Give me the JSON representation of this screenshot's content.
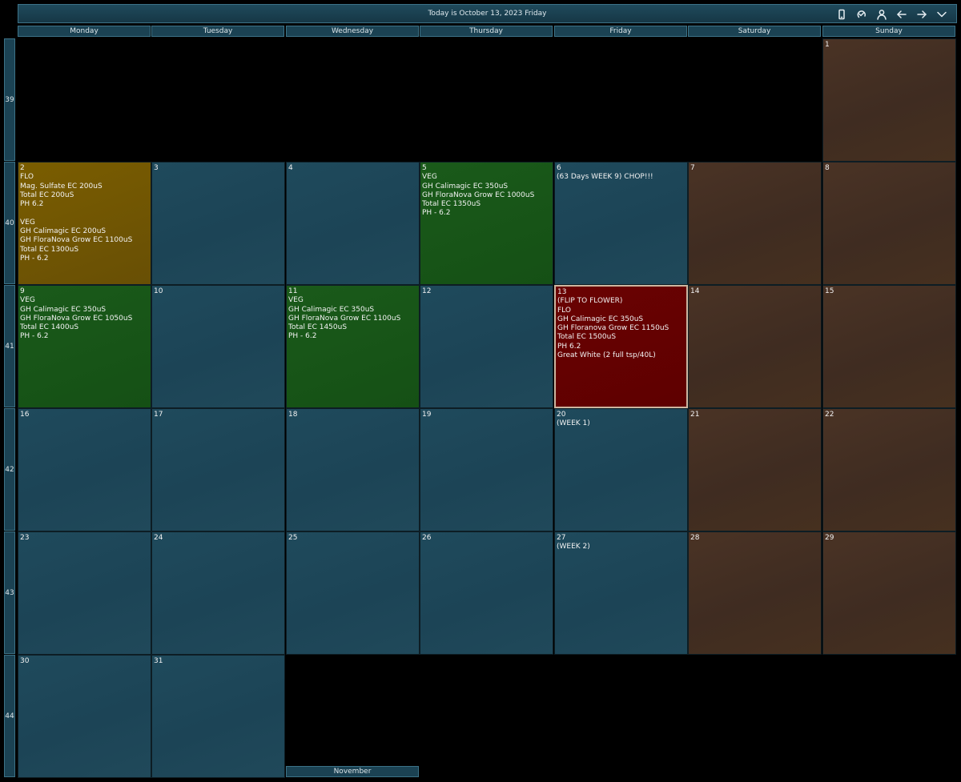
{
  "header": {
    "title": "Today is October 13, 2023 Friday",
    "icons": [
      "phone-icon",
      "sync-icon",
      "user-icon",
      "arrow-left-icon",
      "arrow-right-icon",
      "chevron-down-icon"
    ]
  },
  "days": [
    "Monday",
    "Tuesday",
    "Wednesday",
    "Thursday",
    "Friday",
    "Saturday",
    "Sunday"
  ],
  "weeks": [
    {
      "number": "39",
      "cells": [
        {
          "day": "",
          "type": "empty",
          "note": ""
        },
        {
          "day": "",
          "type": "empty",
          "note": ""
        },
        {
          "day": "",
          "type": "empty",
          "note": ""
        },
        {
          "day": "",
          "type": "empty",
          "note": ""
        },
        {
          "day": "",
          "type": "empty",
          "note": ""
        },
        {
          "day": "",
          "type": "empty",
          "note": ""
        },
        {
          "day": "1",
          "type": "weekend",
          "note": ""
        }
      ]
    },
    {
      "number": "40",
      "cells": [
        {
          "day": "2",
          "type": "flo",
          "note": "FLO\nMag. Sulfate EC 200uS\nTotal EC 200uS\nPH 6.2\n\nVEG\nGH Calimagic EC 200uS\nGH FloraNova Grow EC 1100uS\nTotal EC 1300uS\nPH - 6.2"
        },
        {
          "day": "3",
          "type": "weekday",
          "note": ""
        },
        {
          "day": "4",
          "type": "weekday",
          "note": ""
        },
        {
          "day": "5",
          "type": "veg",
          "note": "VEG\nGH Calimagic EC 350uS\nGH FloraNova Grow EC 1000uS\nTotal EC 1350uS\nPH - 6.2"
        },
        {
          "day": "6",
          "type": "weekday",
          "note": "(63 Days WEEK 9) CHOP!!!"
        },
        {
          "day": "7",
          "type": "weekend",
          "note": ""
        },
        {
          "day": "8",
          "type": "weekend",
          "note": ""
        }
      ]
    },
    {
      "number": "41",
      "cells": [
        {
          "day": "9",
          "type": "veg",
          "note": "VEG\nGH Calimagic EC 350uS\nGH FloraNova Grow EC 1050uS\nTotal EC 1400uS\nPH - 6.2"
        },
        {
          "day": "10",
          "type": "weekday",
          "note": ""
        },
        {
          "day": "11",
          "type": "veg",
          "note": "VEG\nGH Calimagic EC 350uS\nGH FloraNova Grow EC 1100uS\nTotal EC 1450uS\nPH - 6.2"
        },
        {
          "day": "12",
          "type": "weekday",
          "note": ""
        },
        {
          "day": "13",
          "type": "flip",
          "note": "(FLIP TO FLOWER)\nFLO\nGH Calimagic EC 350uS\nGH Floranova Grow EC 1150uS\nTotal EC 1500uS\nPH 6.2\nGreat White (2 full tsp/40L)"
        },
        {
          "day": "14",
          "type": "weekend",
          "note": ""
        },
        {
          "day": "15",
          "type": "weekend",
          "note": ""
        }
      ]
    },
    {
      "number": "42",
      "cells": [
        {
          "day": "16",
          "type": "weekday",
          "note": ""
        },
        {
          "day": "17",
          "type": "weekday",
          "note": ""
        },
        {
          "day": "18",
          "type": "weekday",
          "note": ""
        },
        {
          "day": "19",
          "type": "weekday",
          "note": ""
        },
        {
          "day": "20",
          "type": "weekday",
          "note": "(WEEK 1)"
        },
        {
          "day": "21",
          "type": "weekend",
          "note": ""
        },
        {
          "day": "22",
          "type": "weekend",
          "note": ""
        }
      ]
    },
    {
      "number": "43",
      "cells": [
        {
          "day": "23",
          "type": "weekday",
          "note": ""
        },
        {
          "day": "24",
          "type": "weekday",
          "note": ""
        },
        {
          "day": "25",
          "type": "weekday",
          "note": ""
        },
        {
          "day": "26",
          "type": "weekday",
          "note": ""
        },
        {
          "day": "27",
          "type": "weekday",
          "note": "(WEEK 2)"
        },
        {
          "day": "28",
          "type": "weekend",
          "note": ""
        },
        {
          "day": "29",
          "type": "weekend",
          "note": ""
        }
      ]
    },
    {
      "number": "44",
      "cells": [
        {
          "day": "30",
          "type": "weekday",
          "note": ""
        },
        {
          "day": "31",
          "type": "weekday",
          "note": ""
        },
        {
          "day": "",
          "type": "empty",
          "note": ""
        },
        {
          "day": "",
          "type": "empty",
          "note": ""
        },
        {
          "day": "",
          "type": "empty",
          "note": ""
        },
        {
          "day": "",
          "type": "empty",
          "note": ""
        },
        {
          "day": "",
          "type": "empty",
          "note": ""
        }
      ]
    }
  ],
  "next_month_label": "November",
  "colors": {
    "weekday": "#1f4a5c",
    "weekend": "#45301f",
    "veg": "#155015",
    "flo": "#6e5303",
    "flip": "#650000"
  }
}
